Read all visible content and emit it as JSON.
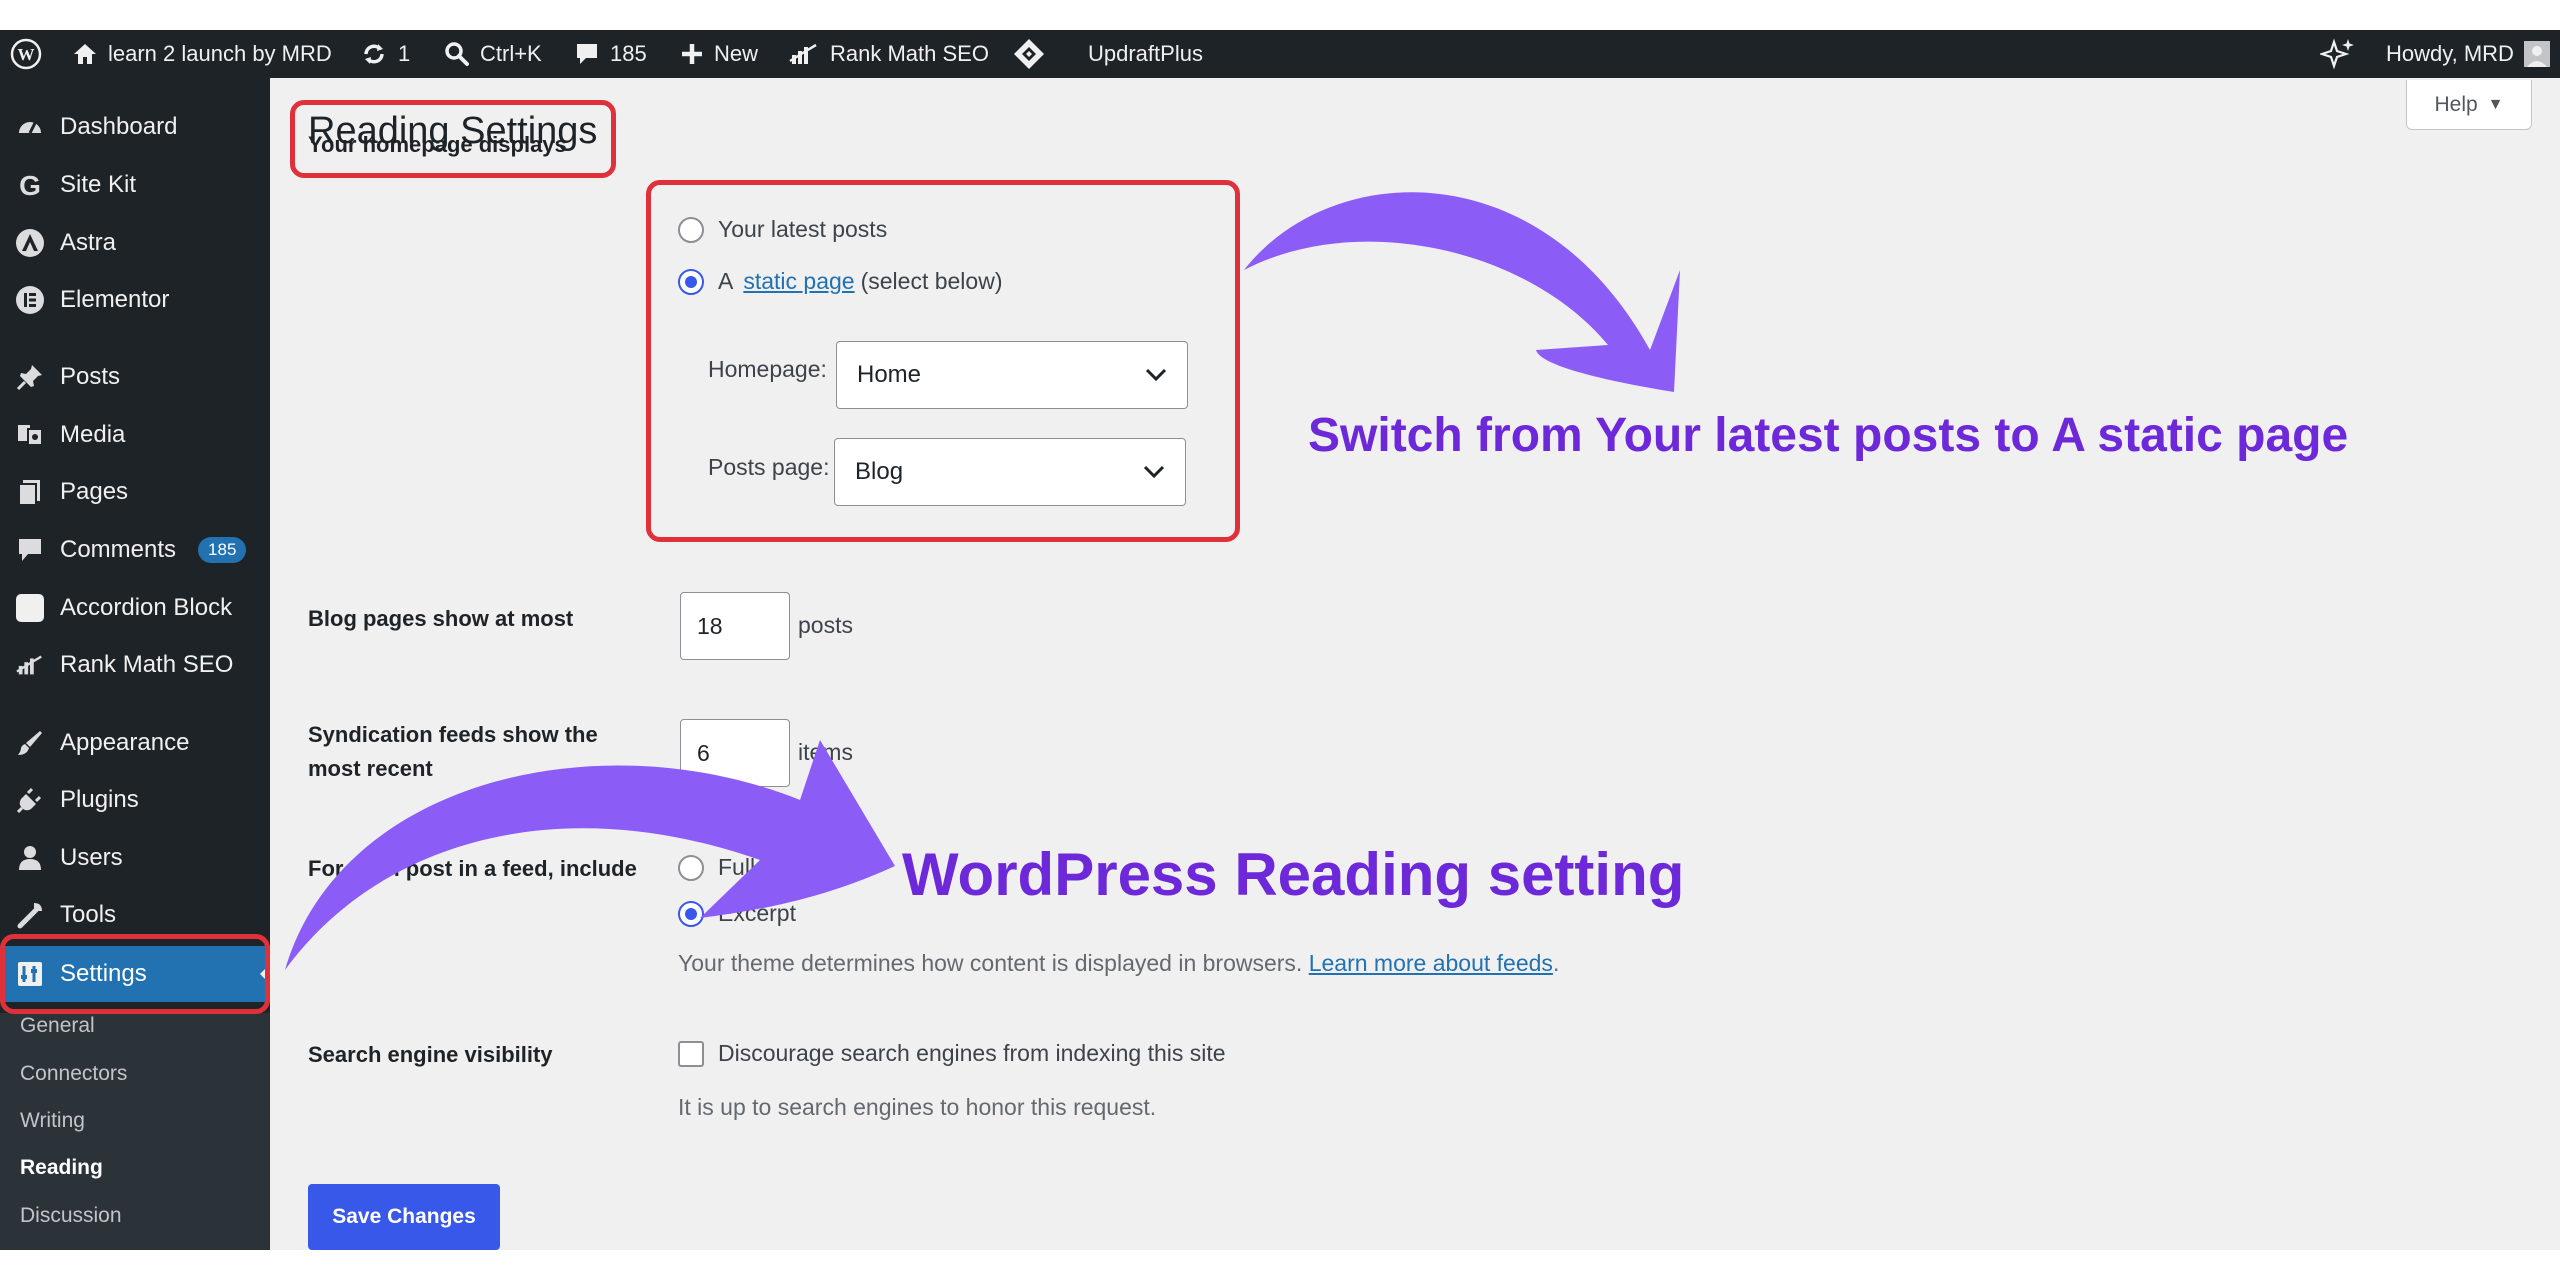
{
  "adminbar": {
    "site_name": "learn 2 launch by MRD",
    "updates_count": "1",
    "search_shortcut": "Ctrl+K",
    "comments_count": "185",
    "new_label": "New",
    "rankmath_label": "Rank Math SEO",
    "updraft_label": "UpdraftPlus",
    "howdy_label": "Howdy, MRD"
  },
  "sidebar": {
    "items": [
      {
        "label": "Dashboard",
        "icon": "dashboard-icon"
      },
      {
        "label": "Site Kit",
        "icon": "google-g-icon"
      },
      {
        "label": "Astra",
        "icon": "astra-icon"
      },
      {
        "label": "Elementor",
        "icon": "elementor-icon"
      },
      {
        "label": "Posts",
        "icon": "pin-icon"
      },
      {
        "label": "Media",
        "icon": "media-icon"
      },
      {
        "label": "Pages",
        "icon": "pages-icon"
      },
      {
        "label": "Comments",
        "icon": "comment-icon",
        "badge": "185"
      },
      {
        "label": "Accordion Block",
        "icon": "square-icon"
      },
      {
        "label": "Rank Math SEO",
        "icon": "rankmath-icon"
      },
      {
        "label": "Appearance",
        "icon": "brush-icon"
      },
      {
        "label": "Plugins",
        "icon": "plug-icon"
      },
      {
        "label": "Users",
        "icon": "user-icon"
      },
      {
        "label": "Tools",
        "icon": "wrench-icon"
      },
      {
        "label": "Settings",
        "icon": "settings-icon"
      }
    ],
    "submenu": [
      {
        "label": "General"
      },
      {
        "label": "Connectors"
      },
      {
        "label": "Writing"
      },
      {
        "label": "Reading"
      },
      {
        "label": "Discussion"
      }
    ]
  },
  "main": {
    "help_label": "Help",
    "page_title": "Reading Settings",
    "homepage_displays": {
      "label": "Your homepage displays",
      "latest_posts": "Your latest posts",
      "static_prefix": "A",
      "static_link": "static page",
      "static_suffix": "(select below)",
      "homepage_label": "Homepage:",
      "homepage_value": "Home",
      "posts_page_label": "Posts page:",
      "posts_page_value": "Blog"
    },
    "blog_pages": {
      "label": "Blog pages show at most",
      "value": "18",
      "unit": "posts"
    },
    "syndication": {
      "label_line1": "Syndication feeds show the",
      "label_line2": "most recent",
      "value": "6",
      "unit": "items"
    },
    "feed_include": {
      "label": "For each post in a feed, include",
      "full_text": "Full text",
      "excerpt": "Excerpt",
      "desc_prefix": "Your theme determines how content is displayed in browsers.",
      "desc_link": "Learn more about feeds",
      "desc_suffix": "."
    },
    "search_visibility": {
      "label": "Search engine visibility",
      "checkbox_label": "Discourage search engines from indexing this site",
      "desc": "It is up to search engines to honor this request."
    },
    "save_label": "Save Changes"
  },
  "annotations": {
    "callout_static": "Switch from Your latest posts to A static page",
    "callout_reading": "WordPress Reading setting",
    "arrow_color": "#8b5cf6",
    "box_color": "#e0303a"
  }
}
